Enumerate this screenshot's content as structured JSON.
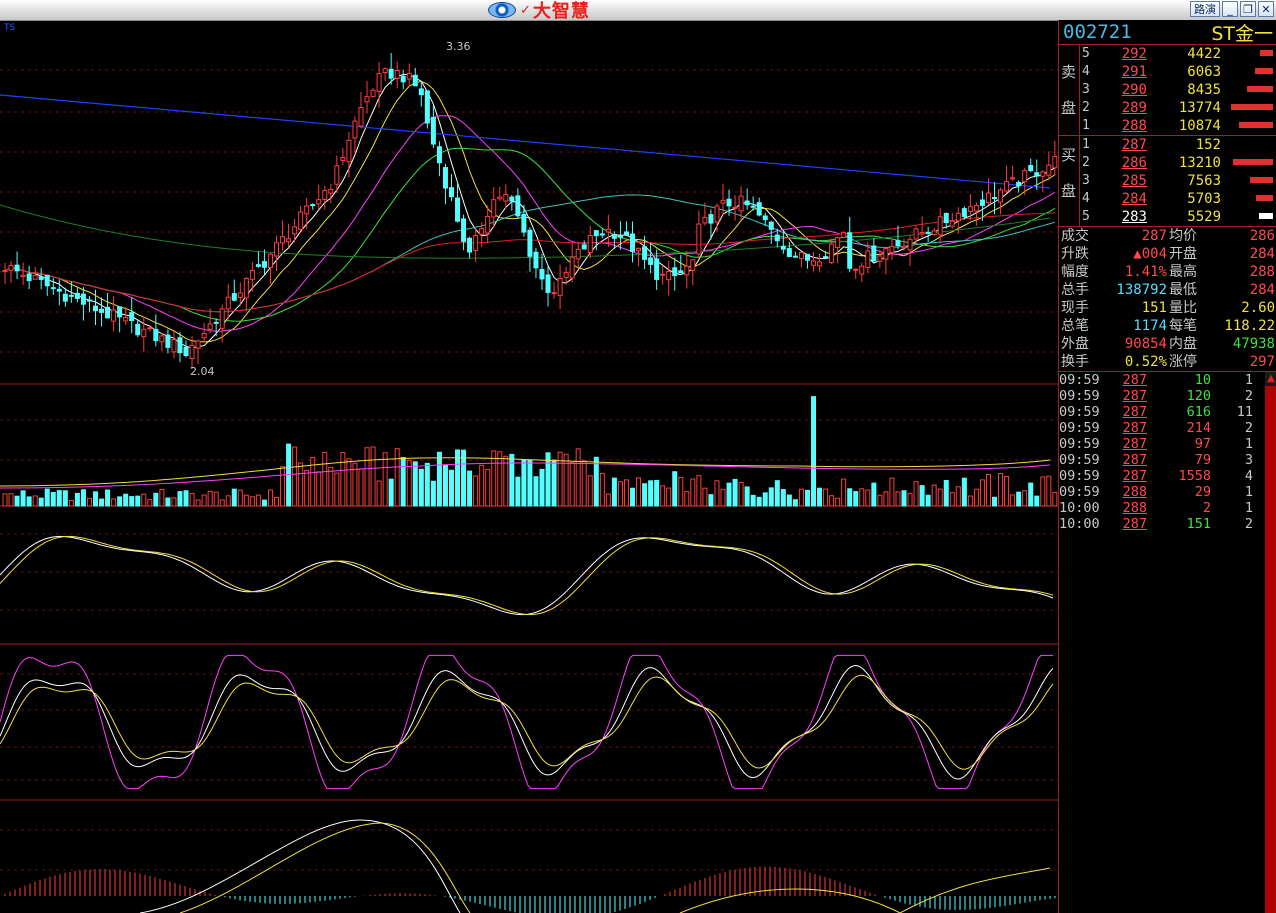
{
  "window": {
    "app_name": "大智慧",
    "route_button": "路演",
    "min_icon": "minimize-icon",
    "max_icon": "restore-icon",
    "close_icon": "close-icon"
  },
  "chart": {
    "high_label": "3.36",
    "low_label": "2.04",
    "panel_label": "TS",
    "candles_color_up": "#ff3c3c",
    "candles_color_down": "#54ffff",
    "ma_colors": [
      "#ffffff",
      "#f0e040",
      "#ff40ff",
      "#40e040",
      "#40c0c0",
      "#e02020",
      "#208020",
      "#2040ff"
    ]
  },
  "quote": {
    "code": "002721",
    "name": "ST金一",
    "sell_label_1": "卖",
    "sell_label_2": "盘",
    "buy_label_1": "买",
    "buy_label_2": "盘",
    "sell": [
      {
        "level": "5",
        "price": "292",
        "vol": "4422",
        "bar": 0.1
      },
      {
        "level": "4",
        "price": "291",
        "vol": "6063",
        "bar": 0.14
      },
      {
        "level": "3",
        "price": "290",
        "vol": "8435",
        "bar": 0.2
      },
      {
        "level": "2",
        "price": "289",
        "vol": "13774",
        "bar": 0.32
      },
      {
        "level": "1",
        "price": "288",
        "vol": "10874",
        "bar": 0.26
      }
    ],
    "buy": [
      {
        "level": "1",
        "price": "287",
        "vol": "152",
        "bar": 0.0
      },
      {
        "level": "2",
        "price": "286",
        "vol": "13210",
        "bar": 0.31
      },
      {
        "level": "3",
        "price": "285",
        "vol": "7563",
        "bar": 0.18
      },
      {
        "level": "4",
        "price": "284",
        "vol": "5703",
        "bar": 0.13
      },
      {
        "level": "5",
        "price": "283",
        "vol": "5529",
        "bar": 0.13
      }
    ],
    "stats": [
      {
        "k1": "成交",
        "v1": "287",
        "c1": "red",
        "k2": "均价",
        "v2": "286",
        "c2": "red"
      },
      {
        "k1": "升跌",
        "v1": "▲004",
        "c1": "red",
        "k2": "开盘",
        "v2": "284",
        "c2": "red"
      },
      {
        "k1": "幅度",
        "v1": "1.41%",
        "c1": "red",
        "k2": "最高",
        "v2": "288",
        "c2": "red"
      },
      {
        "k1": "总手",
        "v1": "138792",
        "c1": "cyan",
        "k2": "最低",
        "v2": "284",
        "c2": "red"
      },
      {
        "k1": "现手",
        "v1": "151",
        "c1": "yel",
        "k2": "量比",
        "v2": "2.60",
        "c2": "yel"
      },
      {
        "k1": "总笔",
        "v1": "1174",
        "c1": "cyan",
        "k2": "每笔",
        "v2": "118.22",
        "c2": "yel"
      },
      {
        "k1": "外盘",
        "v1": "90854",
        "c1": "red",
        "k2": "内盘",
        "v2": "47938",
        "c2": "grn"
      },
      {
        "k1": "换手",
        "v1": "0.52%",
        "c1": "yel",
        "k2": "涨停",
        "v2": "297",
        "c2": "red"
      }
    ],
    "ticks": [
      {
        "time": "09:59",
        "price": "287",
        "vol": "10",
        "vc": "grn",
        "n": "1"
      },
      {
        "time": "09:59",
        "price": "287",
        "vol": "120",
        "vc": "grn",
        "n": "2"
      },
      {
        "time": "09:59",
        "price": "287",
        "vol": "616",
        "vc": "grn",
        "n": "11"
      },
      {
        "time": "09:59",
        "price": "287",
        "vol": "214",
        "vc": "red",
        "n": "2"
      },
      {
        "time": "09:59",
        "price": "287",
        "vol": "97",
        "vc": "red",
        "n": "1"
      },
      {
        "time": "09:59",
        "price": "287",
        "vol": "79",
        "vc": "red",
        "n": "3"
      },
      {
        "time": "09:59",
        "price": "287",
        "vol": "1558",
        "vc": "red",
        "n": "4"
      },
      {
        "time": "09:59",
        "price": "288",
        "vol": "29",
        "vc": "red",
        "n": "1"
      },
      {
        "time": "10:00",
        "price": "288",
        "vol": "2",
        "vc": "red",
        "n": "1"
      },
      {
        "time": "10:00",
        "price": "287",
        "vol": "151",
        "vc": "grn",
        "n": "2"
      }
    ]
  }
}
